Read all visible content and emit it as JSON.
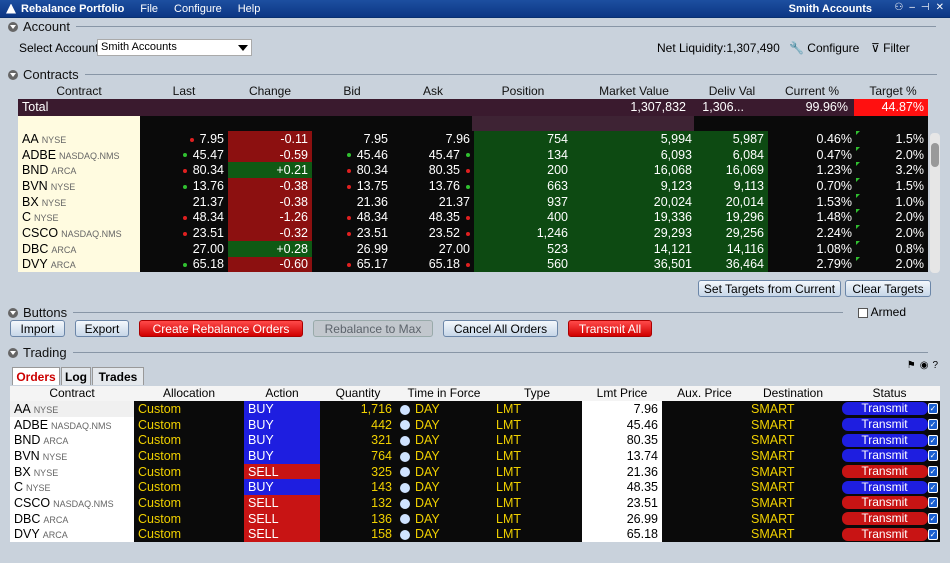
{
  "window": {
    "title": "Rebalance Portfolio",
    "menu": [
      "File",
      "Configure",
      "Help"
    ],
    "account_title": "Smith Accounts"
  },
  "account": {
    "section": "Account",
    "select_label": "Select Account",
    "selected": "Smith Accounts",
    "net_liquidity": "Net Liquidity:1,307,490",
    "configure": "Configure",
    "filter": "Filter"
  },
  "contracts": {
    "section": "Contracts",
    "columns": [
      "Contract",
      "Last",
      "Change",
      "Bid",
      "Ask",
      "Position",
      "Market Value",
      "Deliv Val",
      "Current %",
      "Target %"
    ],
    "total": {
      "label": "Total",
      "market_value": "1,307,832",
      "deliv_val": "1,306...",
      "current": "99.96%",
      "target": "44.87%"
    },
    "rows": [
      {
        "sym": "AA",
        "ex": "NYSE",
        "last": "7.95",
        "ld": "r",
        "chg": "-0.11",
        "bid": "7.95",
        "bd": "",
        "ask": "7.96",
        "ad": "",
        "pos": "754",
        "mv": "5,994",
        "dv": "5,987",
        "cur": "0.46%",
        "tgt": "1.5%"
      },
      {
        "sym": "ADBE",
        "ex": "NASDAQ.NMS",
        "last": "45.47",
        "ld": "g",
        "chg": "-0.59",
        "bid": "45.46",
        "bd": "g",
        "ask": "45.47",
        "ad": "g",
        "pos": "134",
        "mv": "6,093",
        "dv": "6,084",
        "cur": "0.47%",
        "tgt": "2.0%"
      },
      {
        "sym": "BND",
        "ex": "ARCA",
        "last": "80.34",
        "ld": "r",
        "chg": "+0.21",
        "bid": "80.34",
        "bd": "r",
        "ask": "80.35",
        "ad": "r",
        "pos": "200",
        "mv": "16,068",
        "dv": "16,069",
        "cur": "1.23%",
        "tgt": "3.2%"
      },
      {
        "sym": "BVN",
        "ex": "NYSE",
        "last": "13.76",
        "ld": "g",
        "chg": "-0.38",
        "bid": "13.75",
        "bd": "r",
        "ask": "13.76",
        "ad": "g",
        "pos": "663",
        "mv": "9,123",
        "dv": "9,113",
        "cur": "0.70%",
        "tgt": "1.5%"
      },
      {
        "sym": "BX",
        "ex": "NYSE",
        "last": "21.37",
        "ld": "",
        "chg": "-0.38",
        "bid": "21.36",
        "bd": "",
        "ask": "21.37",
        "ad": "",
        "pos": "937",
        "mv": "20,024",
        "dv": "20,014",
        "cur": "1.53%",
        "tgt": "1.0%"
      },
      {
        "sym": "C",
        "ex": "NYSE",
        "last": "48.34",
        "ld": "r",
        "chg": "-1.26",
        "bid": "48.34",
        "bd": "r",
        "ask": "48.35",
        "ad": "r",
        "pos": "400",
        "mv": "19,336",
        "dv": "19,296",
        "cur": "1.48%",
        "tgt": "2.0%"
      },
      {
        "sym": "CSCO",
        "ex": "NASDAQ.NMS",
        "last": "23.51",
        "ld": "r",
        "chg": "-0.32",
        "bid": "23.51",
        "bd": "r",
        "ask": "23.52",
        "ad": "r",
        "pos": "1,246",
        "mv": "29,293",
        "dv": "29,256",
        "cur": "2.24%",
        "tgt": "2.0%"
      },
      {
        "sym": "DBC",
        "ex": "ARCA",
        "last": "27.00",
        "ld": "",
        "chg": "+0.28",
        "bid": "26.99",
        "bd": "",
        "ask": "27.00",
        "ad": "",
        "pos": "523",
        "mv": "14,121",
        "dv": "14,116",
        "cur": "1.08%",
        "tgt": "0.8%"
      },
      {
        "sym": "DVY",
        "ex": "ARCA",
        "last": "65.18",
        "ld": "g",
        "chg": "-0.60",
        "bid": "65.17",
        "bd": "r",
        "ask": "65.18",
        "ad": "r",
        "pos": "560",
        "mv": "36,501",
        "dv": "36,464",
        "cur": "2.79%",
        "tgt": "2.0%"
      }
    ],
    "set_targets": "Set Targets from Current",
    "clear_targets": "Clear Targets"
  },
  "buttons": {
    "section": "Buttons",
    "armed": "Armed",
    "import": "Import",
    "export": "Export",
    "create": "Create Rebalance Orders",
    "rebalance_max": "Rebalance to Max",
    "cancel_all": "Cancel All Orders",
    "transmit_all": "Transmit All"
  },
  "trading": {
    "section": "Trading",
    "tabs": [
      "Orders",
      "Log",
      "Trades"
    ],
    "columns": [
      "Contract",
      "Allocation",
      "Action",
      "Quantity",
      "Time in Force",
      "Type",
      "Lmt Price",
      "Aux. Price",
      "Destination",
      "Status"
    ],
    "rows": [
      {
        "sym": "AA",
        "ex": "NYSE",
        "alloc": "Custom",
        "action": "BUY",
        "qty": "1,716",
        "tif": "DAY",
        "type": "LMT",
        "lmt": "7.96",
        "dest": "SMART",
        "status": "Transmit"
      },
      {
        "sym": "ADBE",
        "ex": "NASDAQ.NMS",
        "alloc": "Custom",
        "action": "BUY",
        "qty": "442",
        "tif": "DAY",
        "type": "LMT",
        "lmt": "45.46",
        "dest": "SMART",
        "status": "Transmit"
      },
      {
        "sym": "BND",
        "ex": "ARCA",
        "alloc": "Custom",
        "action": "BUY",
        "qty": "321",
        "tif": "DAY",
        "type": "LMT",
        "lmt": "80.35",
        "dest": "SMART",
        "status": "Transmit"
      },
      {
        "sym": "BVN",
        "ex": "NYSE",
        "alloc": "Custom",
        "action": "BUY",
        "qty": "764",
        "tif": "DAY",
        "type": "LMT",
        "lmt": "13.74",
        "dest": "SMART",
        "status": "Transmit"
      },
      {
        "sym": "BX",
        "ex": "NYSE",
        "alloc": "Custom",
        "action": "SELL",
        "qty": "325",
        "tif": "DAY",
        "type": "LMT",
        "lmt": "21.36",
        "dest": "SMART",
        "status": "Transmit"
      },
      {
        "sym": "C",
        "ex": "NYSE",
        "alloc": "Custom",
        "action": "BUY",
        "qty": "143",
        "tif": "DAY",
        "type": "LMT",
        "lmt": "48.35",
        "dest": "SMART",
        "status": "Transmit"
      },
      {
        "sym": "CSCO",
        "ex": "NASDAQ.NMS",
        "alloc": "Custom",
        "action": "SELL",
        "qty": "132",
        "tif": "DAY",
        "type": "LMT",
        "lmt": "23.51",
        "dest": "SMART",
        "status": "Transmit"
      },
      {
        "sym": "DBC",
        "ex": "ARCA",
        "alloc": "Custom",
        "action": "SELL",
        "qty": "136",
        "tif": "DAY",
        "type": "LMT",
        "lmt": "26.99",
        "dest": "SMART",
        "status": "Transmit"
      },
      {
        "sym": "DVY",
        "ex": "ARCA",
        "alloc": "Custom",
        "action": "SELL",
        "qty": "158",
        "tif": "DAY",
        "type": "LMT",
        "lmt": "65.18",
        "dest": "SMART",
        "status": "Transmit"
      }
    ]
  },
  "colors": {
    "buy": "#1e1ee0",
    "sell": "#c81414",
    "pos_green": "#0d4a12",
    "neg_red": "#8c1010",
    "up_green": "#0f5a14",
    "accent": "#0c3684"
  }
}
